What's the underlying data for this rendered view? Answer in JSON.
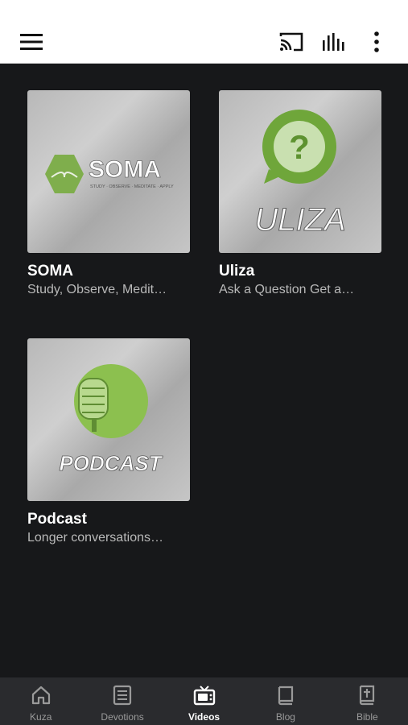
{
  "top_bar": {
    "icons": [
      "menu-icon",
      "cast-icon",
      "audio-bars-icon",
      "more-vertical-icon"
    ]
  },
  "cards": [
    {
      "title": "SOMA",
      "subtitle": "Study, Observe, Medit…",
      "logo_text": "SOMA",
      "tagline": "STUDY · OBSERVE · MEDITATE · APPLY",
      "accent": "#7fae4c"
    },
    {
      "title": "Uliza",
      "subtitle": "Ask a Question Get a…",
      "logo_text": "ULIZA",
      "accent": "#6fa63a"
    },
    {
      "title": "Podcast",
      "subtitle": "Longer conversations…",
      "logo_text": "PODCAST",
      "accent": "#8cc04f"
    }
  ],
  "bottom_nav": {
    "items": [
      {
        "label": "Kuza",
        "icon": "home-icon",
        "active": false
      },
      {
        "label": "Devotions",
        "icon": "document-icon",
        "active": false
      },
      {
        "label": "Videos",
        "icon": "tv-icon",
        "active": true
      },
      {
        "label": "Blog",
        "icon": "book-icon",
        "active": false
      },
      {
        "label": "Bible",
        "icon": "bible-icon",
        "active": false
      }
    ]
  }
}
